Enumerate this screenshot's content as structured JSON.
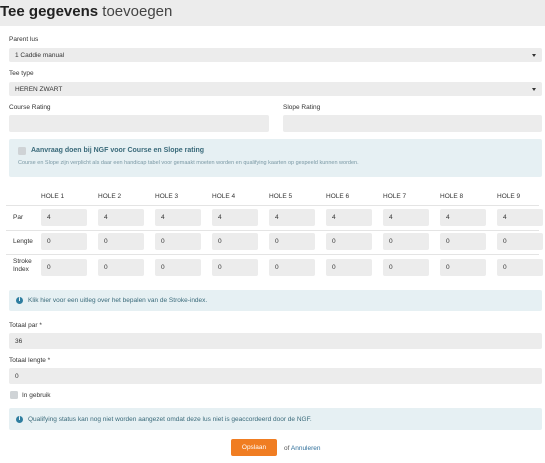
{
  "header": {
    "title_bold": "Tee gegevens",
    "title_light": "toevoegen"
  },
  "parent_lus": {
    "label": "Parent lus",
    "value": "1 Caddie manual"
  },
  "tee_type": {
    "label": "Tee type",
    "value": "HEREN ZWART"
  },
  "course_rating": {
    "label": "Course Rating",
    "value": ""
  },
  "slope_rating": {
    "label": "Slope Rating",
    "value": ""
  },
  "ngf_request": {
    "checked": false,
    "title": "Aanvraag doen bij NGF voor Course en Slope rating",
    "text": "Course en Slope zijn verplicht als daar een handicap tabel voor gemaakt moeten worden en qualifying kaarten op gespeeld kunnen worden."
  },
  "holes": {
    "headers": [
      "HOLE 1",
      "HOLE 2",
      "HOLE 3",
      "HOLE 4",
      "HOLE 5",
      "HOLE 6",
      "HOLE 7",
      "HOLE 8",
      "HOLE 9"
    ],
    "rows": [
      {
        "label": "Par",
        "values": [
          "4",
          "4",
          "4",
          "4",
          "4",
          "4",
          "4",
          "4",
          "4"
        ]
      },
      {
        "label": "Lengte",
        "values": [
          "0",
          "0",
          "0",
          "0",
          "0",
          "0",
          "0",
          "0",
          "0"
        ]
      },
      {
        "label": "Stroke Index",
        "values": [
          "0",
          "0",
          "0",
          "0",
          "0",
          "0",
          "0",
          "0",
          "0"
        ]
      }
    ]
  },
  "stroke_info": {
    "text": "Klik hier voor een uitleg over het bepalen van de Stroke-index."
  },
  "totaal_par": {
    "label": "Totaal par *",
    "value": "36"
  },
  "totaal_lengte": {
    "label": "Totaal lengte *",
    "value": "0"
  },
  "in_gebruik": {
    "label": "In gebruik",
    "checked": false
  },
  "qualifying_info": {
    "text": "Qualifying status kan nog niet worden aangezet omdat deze lus niet is geaccordeerd door de NGF."
  },
  "footer": {
    "save_label": "Opslaan",
    "or_text": "of",
    "cancel_label": "Annuleren"
  },
  "colors": {
    "accent": "#f07d22",
    "info_bg": "#e6f0f3",
    "info_text": "#3a6a7a",
    "field_bg": "#ececec"
  },
  "icons": {
    "dropdown": "caret-down-icon",
    "info": "info-circle-icon"
  }
}
